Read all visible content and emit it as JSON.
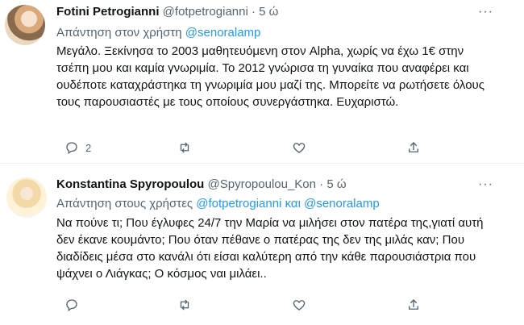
{
  "tweets": [
    {
      "author": "Fotini Petrogianni",
      "handle": "@fotpetrogianni",
      "separator": "·",
      "time": "5 ώ",
      "more": "···",
      "reply_prefix": "Απάντηση στον χρήστη",
      "mentions": [
        "@senoralamp"
      ],
      "mention_joiner": "",
      "text": "Μεγάλο. Ξεκίνησα το 2003 μαθητευόμενη στον Alpha, χωρίς να έχω 1€ στην τσέπη μου και καμία γνωριμία. Το 2012 γνώρισα τη γυναίκα που αναφέρει και ουδέποτε καταχράστηκα τη γνωριμία μου μαζί της. Μπορείτε να ρωτήσετε όλους τους παρουσιαστές με τους οποίους συνεργάστηκα. Ευχαριστώ.",
      "reply_count": "2",
      "retweet_count": "",
      "like_count": ""
    },
    {
      "author": "Konstantina Spyropoulou",
      "handle": "@Spyropoulou_Kon",
      "separator": "·",
      "time": "5 ώ",
      "more": "···",
      "reply_prefix": "Απάντηση στους χρήστες",
      "mentions": [
        "@fotpetrogianni",
        "@senoralamp"
      ],
      "mention_joiner": "και",
      "text": "Να πούνε τι; Που έγλυφες 24/7 την Μαρία να μιλήσει στον πατέρα της,γιατί αυτή δεν έκανε κουμάντο; Που όταν πέθανε ο πατέρας της δεν της μιλάς καν; Που διαδίδεις μέσα στο κανάλι ότι είσαι καλύτερη από την κάθε παρουσιάστρια που ψάχνει ο Λιάγκας; Ο κόσμος ναι μιλάει..",
      "reply_count": "",
      "retweet_count": "",
      "like_count": ""
    }
  ],
  "icons": {
    "reply": "reply-icon",
    "retweet": "retweet-icon",
    "like": "like-icon",
    "share": "share-icon",
    "more": "more-icon"
  },
  "colors": {
    "text": "#0f1419",
    "secondary": "#536471",
    "mention": "#1d9bf0",
    "divider": "#eff3f4"
  }
}
